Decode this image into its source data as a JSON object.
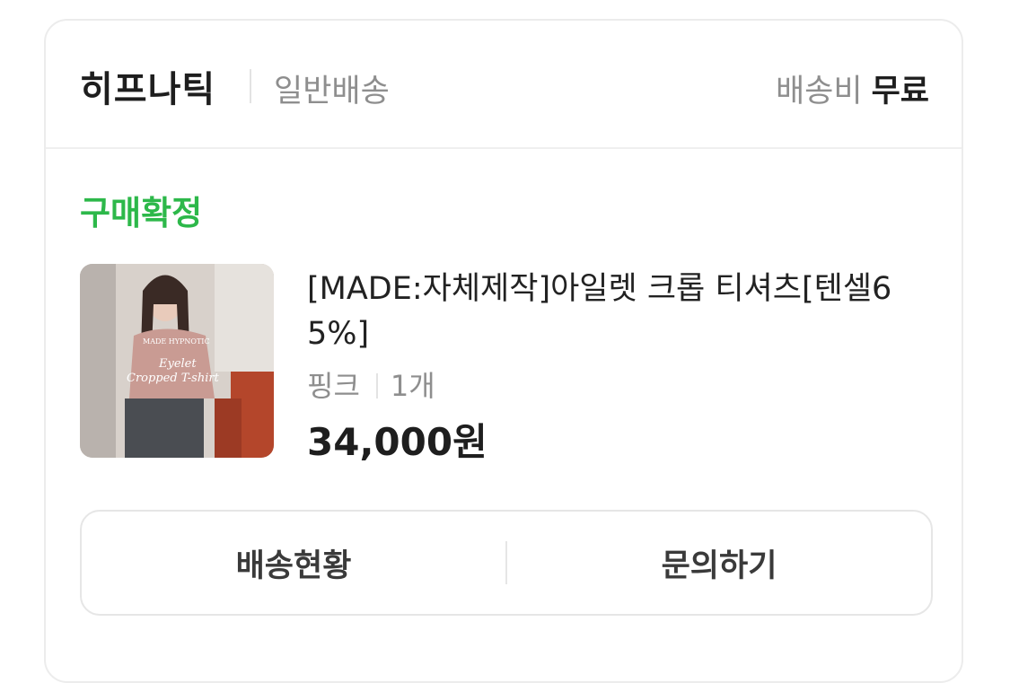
{
  "header": {
    "store_name": "히프나틱",
    "shipping_type": "일반배송",
    "shipping_fee_label": "배송비",
    "shipping_fee_value": "무료"
  },
  "order": {
    "status": "구매확정",
    "product": {
      "thumbnail_icon": "product-thumbnail-photo",
      "thumbnail_text": [
        "MADE HYPNOTIC",
        "Eyelet",
        "Cropped T-shirt"
      ],
      "title": "[MADE:자체제작]아일렛 크롭 티셔츠[텐셀65%]",
      "option": "핑크",
      "quantity": "1개",
      "price": "34,000원"
    }
  },
  "actions": {
    "track_label": "배송현황",
    "inquiry_label": "문의하기"
  },
  "colors": {
    "status_green": "#2db84a",
    "text_primary": "#1e1e1e",
    "text_secondary": "#8e8e8e",
    "border": "#ececec"
  }
}
